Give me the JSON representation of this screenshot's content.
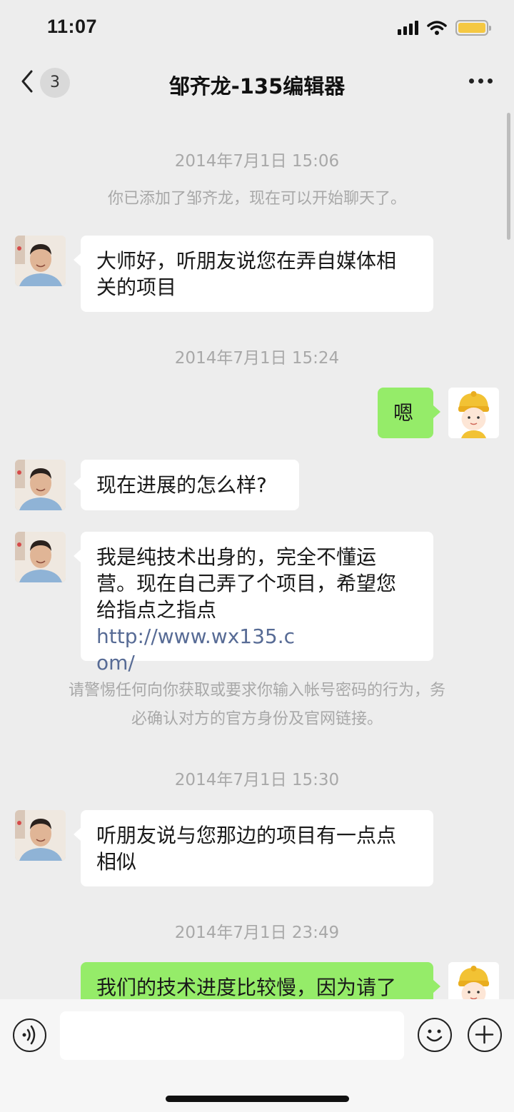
{
  "status_bar": {
    "time": "11:07",
    "battery_color": "#f5c842"
  },
  "nav": {
    "unread_count": "3",
    "title": "邹齐龙-135编辑器"
  },
  "messages": {
    "ts1": "2014年7月1日 15:06",
    "sys_added": "你已添加了邹齐龙，现在可以开始聊天了。",
    "m1": [
      "大师好，听朋友说您在弄自媒体相",
      "关的项目"
    ],
    "ts2": "2014年7月1日 15:24",
    "m2": "嗯",
    "m3": "现在进展的怎么样?",
    "m4": [
      "我是纯技术出身的，完全不懂运",
      "营。现在自己弄了个项目，希望您",
      "给指点之指点 "
    ],
    "m4_link": [
      "http://www.wx135.c",
      "om/"
    ],
    "sys_warn": [
      "请警惕任何向你获取或要求你输入帐号密码的行为，务",
      "必确认对方的官方身份及官网链接。"
    ],
    "ts3": "2014年7月1日 15:30",
    "m5": [
      "听朋友说与您那边的项目有一点点",
      "相似"
    ],
    "ts4": "2014年7月1日 23:49",
    "m6": "我们的技术进度比较慢，因为请了"
  },
  "colors": {
    "outgoing_bubble": "#95ec69",
    "incoming_bubble": "#ffffff",
    "link": "#576b95",
    "background": "#ededed"
  },
  "input": {
    "placeholder": ""
  },
  "icons": {
    "back": "chevron-left-icon",
    "more": "more-dots-icon",
    "voice": "voice-icon",
    "emoji": "emoji-icon",
    "plus": "plus-icon"
  }
}
